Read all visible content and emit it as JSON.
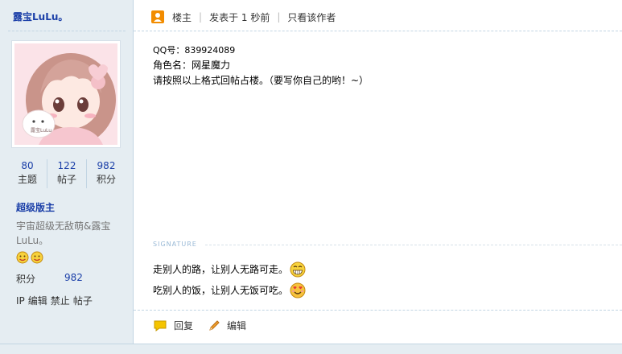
{
  "sidebar": {
    "username": "露宝LuLu。",
    "stats": [
      {
        "value": "80",
        "label": "主题"
      },
      {
        "value": "122",
        "label": "帖子"
      },
      {
        "value": "982",
        "label": "积分"
      }
    ],
    "group": "超级版主",
    "bio": "宇宙超级无敌萌&露宝LuLu。",
    "credit_label": "积分",
    "credit_value": "982",
    "admin_links": [
      "IP",
      "编辑",
      "禁止",
      "帖子"
    ],
    "avatar_badge": "露宝LuLu"
  },
  "post": {
    "header": {
      "author_label": "楼主",
      "posted": "发表于 1 秒前",
      "only_author": "只看该作者"
    },
    "lines": [
      "QQ号：839924089",
      "角色名：网星魔力",
      "请按照以上格式回帖占楼。（要写你自己的哟！~）"
    ],
    "signature_title": "SIGNATURE",
    "signature_lines": [
      "走别人的路，让别人无路可走。",
      "吃别人的饭，让别人无饭可吃。"
    ],
    "footer": {
      "reply": "回复",
      "edit": "编辑"
    }
  },
  "colors": {
    "sidebar_bg": "#e5edf2",
    "link_blue": "#1b3fa8",
    "border": "#c2d5e3"
  }
}
